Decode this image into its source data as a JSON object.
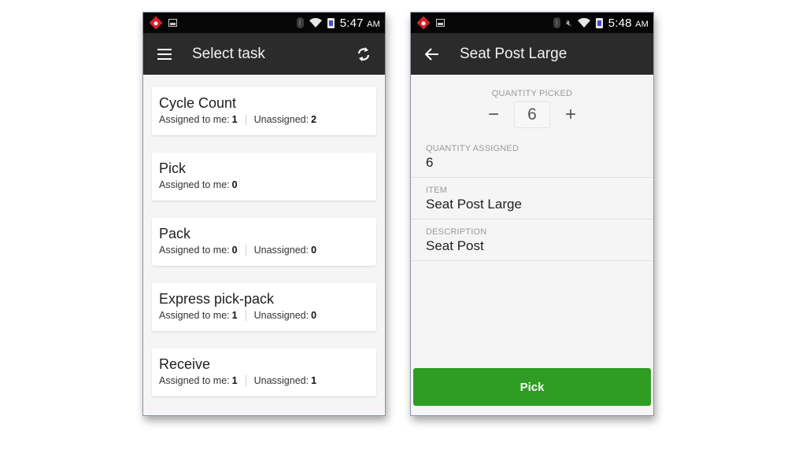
{
  "left_screen": {
    "status_bar": {
      "time": "5:47",
      "ampm": "AM",
      "icons": [
        "app-notification-icon",
        "image-icon",
        "bluetooth-icon",
        "wifi-icon",
        "battery-icon"
      ]
    },
    "app_bar": {
      "menu_icon": "hamburger-menu-icon",
      "title": "Select task",
      "action_icon": "refresh-icon"
    },
    "tasks": [
      {
        "title": "Cycle Count",
        "assigned_label": "Assigned to me:",
        "assigned": "1",
        "unassigned_label": "Unassigned:",
        "unassigned": "2"
      },
      {
        "title": "Pick",
        "assigned_label": "Assigned to me:",
        "assigned": "0"
      },
      {
        "title": "Pack",
        "assigned_label": "Assigned to me:",
        "assigned": "0",
        "unassigned_label": "Unassigned:",
        "unassigned": "0"
      },
      {
        "title": "Express pick-pack",
        "assigned_label": "Assigned to me:",
        "assigned": "1",
        "unassigned_label": "Unassigned:",
        "unassigned": "0"
      },
      {
        "title": "Receive",
        "assigned_label": "Assigned to me:",
        "assigned": "1",
        "unassigned_label": "Unassigned:",
        "unassigned": "1"
      }
    ]
  },
  "right_screen": {
    "status_bar": {
      "time": "5:48",
      "ampm": "AM",
      "icons": [
        "app-notification-icon",
        "image-icon",
        "bluetooth-icon",
        "mute-icon",
        "wifi-icon",
        "battery-icon"
      ]
    },
    "app_bar": {
      "back_icon": "back-arrow-icon",
      "title": "Seat Post Large"
    },
    "quantity_picked": {
      "label": "QUANTITY PICKED",
      "value": "6",
      "minus": "−",
      "plus": "+"
    },
    "fields": [
      {
        "label": "QUANTITY ASSIGNED",
        "value": "6"
      },
      {
        "label": "ITEM",
        "value": "Seat Post Large"
      },
      {
        "label": "DESCRIPTION",
        "value": "Seat Post"
      }
    ],
    "pick_button": {
      "label": "Pick",
      "color": "#2e9e22"
    }
  }
}
